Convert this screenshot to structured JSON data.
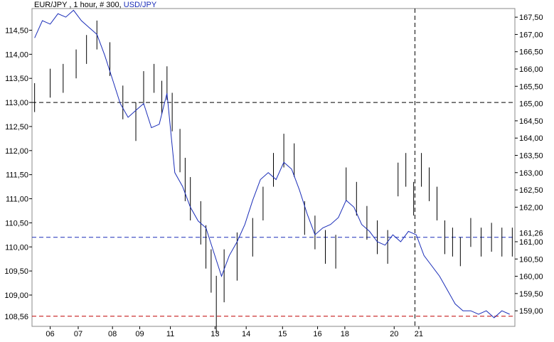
{
  "header": {
    "symbol": "EUR/JPY",
    "info": " , 1 hour, # 300,",
    "overlay_symbol": "USD/JPY"
  },
  "colors": {
    "primary": "#000000",
    "overlay": "#1a2db8",
    "hline_primary": "#000000",
    "hline_overlay": "#1a2db8",
    "hline_low": "#c00000",
    "label_overlay": "#1a2db8",
    "label_low": "#c00000"
  },
  "chart_data": {
    "type": "line",
    "title": "EUR/JPY , 1 hour, # 300, USD/JPY",
    "left_axis": {
      "ticks": [
        "114,50",
        "114,00",
        "113,50",
        "113,00",
        "112,50",
        "112,00",
        "111,50",
        "111,00",
        "110,50",
        "110,00",
        "109,50",
        "109,00"
      ],
      "tick_values": [
        114.5,
        114.0,
        113.5,
        113.0,
        112.5,
        112.0,
        111.5,
        111.0,
        110.5,
        110.0,
        109.5,
        109.0
      ],
      "ylim": [
        108.35,
        114.95
      ],
      "marker_label": "108,56",
      "marker_value": 108.56
    },
    "right_axis": {
      "ticks": [
        "167,50",
        "167,00",
        "166,50",
        "166,00",
        "165,50",
        "164,50",
        "164,00",
        "163,50",
        "163,00",
        "162,50",
        "162,00",
        "161,00",
        "160,50",
        "160,00",
        "159,50",
        "159,00"
      ],
      "tick_values": [
        167.5,
        167.0,
        166.5,
        166.0,
        165.5,
        164.5,
        164.0,
        163.5,
        163.0,
        162.5,
        162.0,
        161.0,
        160.5,
        160.0,
        159.5,
        159.0
      ],
      "ylim": [
        158.55,
        167.75
      ],
      "marker_labels": [
        "165,00",
        "161,26"
      ],
      "marker_values": [
        165.0,
        161.26
      ]
    },
    "x_axis": {
      "labels": [
        "06",
        "07",
        "08",
        "09",
        "11",
        "13",
        "14",
        "15",
        "16",
        "18",
        "20",
        "21"
      ],
      "label_positions": [
        0.0,
        0.108,
        0.24,
        0.345,
        0.463,
        0.635,
        0.755,
        0.895,
        1.03,
        1.135,
        1.325,
        1.42
      ],
      "range": [
        -0.07,
        1.79
      ]
    },
    "horizontal_lines": [
      {
        "axis": "left",
        "value": 113.0,
        "style": "dashed",
        "color": "#000000"
      },
      {
        "axis": "left",
        "value": 110.2,
        "style": "dashed",
        "color": "#1a2db8"
      },
      {
        "axis": "left",
        "value": 108.56,
        "style": "dashed",
        "color": "#c00000"
      }
    ],
    "vertical_line": {
      "x": 1.405,
      "style": "dashed"
    },
    "series": [
      {
        "name": "EUR/JPY",
        "axis": "left",
        "style": "bars",
        "x": [
          -0.06,
          0.0,
          0.05,
          0.1,
          0.14,
          0.18,
          0.23,
          0.28,
          0.33,
          0.36,
          0.4,
          0.43,
          0.45,
          0.47,
          0.5,
          0.52,
          0.54,
          0.58,
          0.6,
          0.62,
          0.64,
          0.67,
          0.72,
          0.78,
          0.82,
          0.86,
          0.9,
          0.94,
          0.98,
          1.02,
          1.06,
          1.1,
          1.14,
          1.18,
          1.22,
          1.26,
          1.3,
          1.34,
          1.37,
          1.4,
          1.43,
          1.46,
          1.49,
          1.52,
          1.55,
          1.58,
          1.62,
          1.66,
          1.7,
          1.74,
          1.78
        ],
        "values": [
          113.1,
          113.4,
          113.5,
          113.8,
          114.1,
          114.4,
          113.9,
          113.0,
          112.6,
          113.3,
          113.5,
          113.1,
          113.4,
          112.8,
          112.0,
          111.4,
          111.0,
          110.5,
          110.0,
          109.5,
          108.8,
          109.4,
          109.8,
          110.2,
          110.9,
          111.6,
          112.0,
          111.8,
          110.6,
          110.3,
          110.0,
          109.9,
          111.3,
          111.0,
          110.5,
          110.2,
          110.0,
          111.4,
          111.6,
          111.0,
          111.6,
          111.3,
          110.9,
          110.2,
          110.1,
          109.9,
          110.3,
          110.1,
          110.2,
          110.1,
          110.1
        ],
        "ranges": [
          0.3,
          0.3,
          0.3,
          0.3,
          0.3,
          0.3,
          0.35,
          0.35,
          0.4,
          0.35,
          0.3,
          0.35,
          0.35,
          0.4,
          0.45,
          0.45,
          0.45,
          0.45,
          0.45,
          0.45,
          0.6,
          0.55,
          0.5,
          0.4,
          0.35,
          0.35,
          0.35,
          0.35,
          0.35,
          0.35,
          0.35,
          0.35,
          0.35,
          0.35,
          0.35,
          0.35,
          0.35,
          0.35,
          0.35,
          0.35,
          0.35,
          0.35,
          0.35,
          0.35,
          0.3,
          0.3,
          0.3,
          0.3,
          0.3,
          0.3,
          0.3
        ]
      },
      {
        "name": "USD/JPY",
        "axis": "right",
        "style": "line",
        "x": [
          -0.06,
          -0.03,
          0.0,
          0.03,
          0.06,
          0.09,
          0.12,
          0.15,
          0.18,
          0.21,
          0.24,
          0.27,
          0.3,
          0.33,
          0.36,
          0.39,
          0.42,
          0.45,
          0.48,
          0.51,
          0.54,
          0.57,
          0.6,
          0.63,
          0.66,
          0.69,
          0.72,
          0.75,
          0.78,
          0.81,
          0.84,
          0.87,
          0.9,
          0.93,
          0.96,
          0.99,
          1.02,
          1.05,
          1.08,
          1.11,
          1.14,
          1.17,
          1.2,
          1.23,
          1.26,
          1.29,
          1.32,
          1.35,
          1.38,
          1.41,
          1.44,
          1.47,
          1.5,
          1.53,
          1.56,
          1.59,
          1.62,
          1.65,
          1.68,
          1.71,
          1.74,
          1.77
        ],
        "values": [
          166.9,
          167.4,
          167.3,
          167.6,
          167.5,
          167.7,
          167.4,
          167.2,
          167.0,
          166.4,
          165.7,
          165.0,
          164.6,
          164.8,
          165.0,
          164.3,
          164.4,
          165.3,
          163.0,
          162.6,
          162.0,
          161.6,
          161.4,
          160.7,
          160.0,
          160.6,
          161.0,
          161.5,
          162.2,
          162.8,
          163.0,
          162.8,
          163.3,
          163.1,
          162.5,
          161.8,
          161.2,
          161.4,
          161.5,
          161.7,
          162.2,
          162.0,
          161.5,
          161.3,
          161.0,
          160.9,
          161.2,
          161.0,
          161.3,
          161.2,
          160.6,
          160.3,
          160.0,
          159.6,
          159.2,
          159.0,
          159.0,
          158.9,
          159.0,
          158.8,
          159.0,
          158.9
        ]
      }
    ]
  }
}
